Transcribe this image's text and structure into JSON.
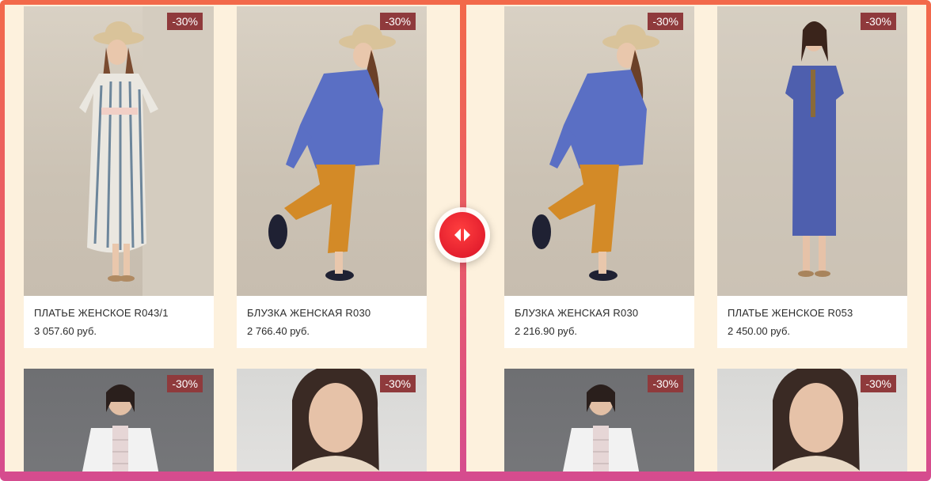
{
  "colors": {
    "frame_top": "#f2694a",
    "frame_bottom": "#d54c8f",
    "pane_background": "#fdf1dd",
    "badge": "#8f3a3c",
    "compare_button": "#e41f2e"
  },
  "left_pane": {
    "products": [
      {
        "name": "ПЛАТЬЕ ЖЕНСКОЕ R043/1",
        "price": "3 057.60 руб.",
        "discount": "-30%"
      },
      {
        "name": "БЛУЗКА ЖЕНСКАЯ R030",
        "price": "2 766.40 руб.",
        "discount": "-30%"
      },
      {
        "discount": "-30%"
      },
      {
        "discount": "-30%"
      }
    ]
  },
  "right_pane": {
    "products": [
      {
        "name": "БЛУЗКА ЖЕНСКАЯ R030",
        "price": "2 216.90 руб.",
        "discount": "-30%"
      },
      {
        "name": "ПЛАТЬЕ ЖЕНСКОЕ R053",
        "price": "2 450.00 руб.",
        "discount": "-30%"
      },
      {
        "discount": "-30%"
      },
      {
        "discount": "-30%"
      }
    ]
  },
  "compare_handle": {
    "icon": "left-right-arrows-icon"
  }
}
